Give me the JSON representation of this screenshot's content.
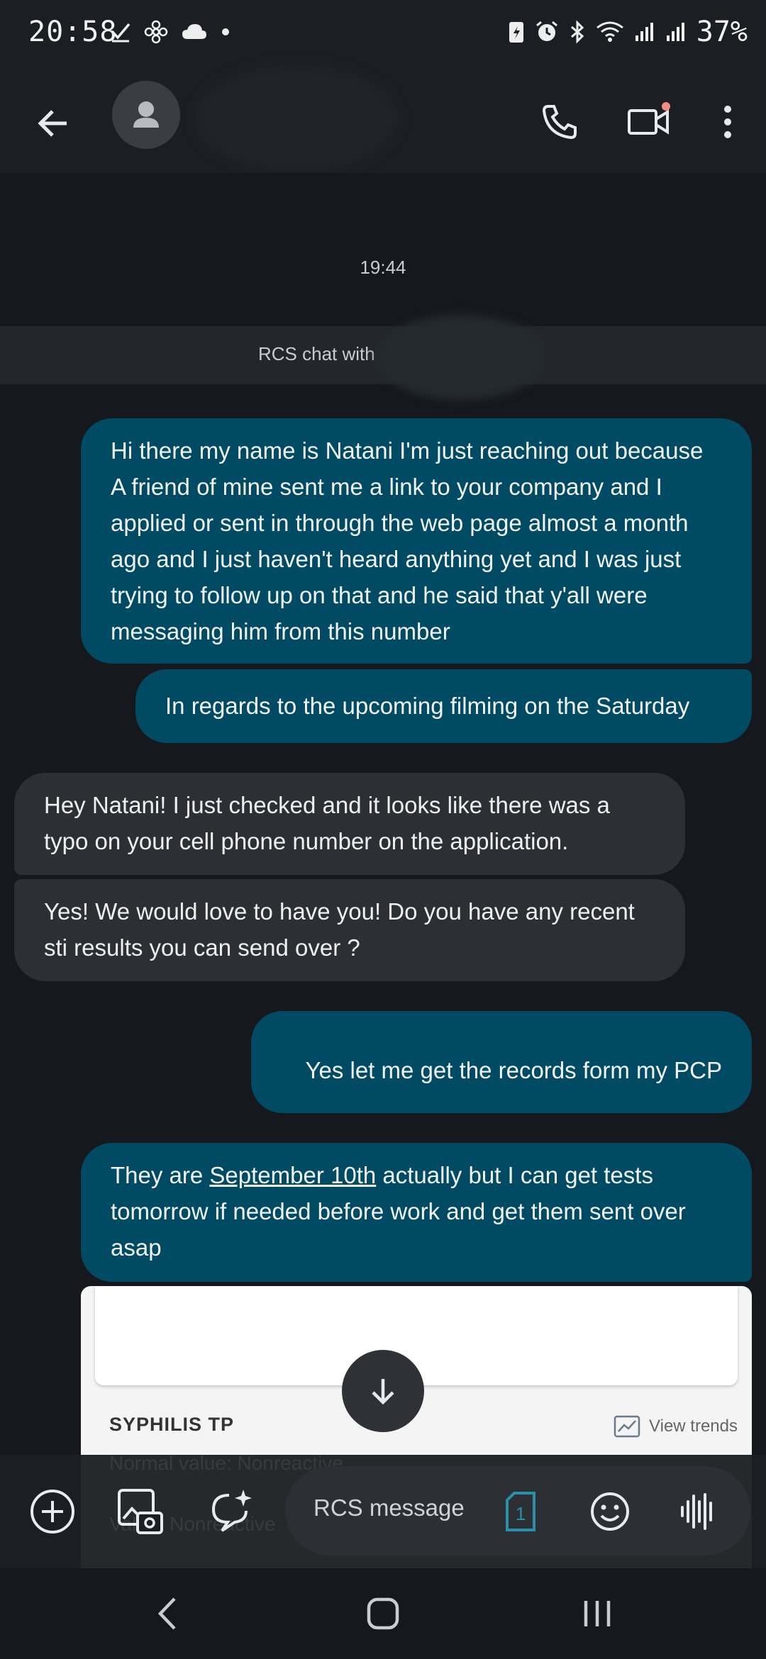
{
  "status_bar": {
    "time": "20:58",
    "battery": "37%",
    "icons": [
      "check-icon",
      "fan-icon",
      "cloud-icon",
      "dot-icon",
      "battery-saver-icon",
      "alarm-icon",
      "bluetooth-icon",
      "wifi-icon",
      "signal-icon",
      "signal-icon",
      "battery-icon"
    ]
  },
  "app_bar": {
    "icons": [
      "back-arrow-icon",
      "person-icon",
      "phone-icon",
      "video-call-icon",
      "more-vert-icon"
    ]
  },
  "conversation": {
    "timestamp": "19:44",
    "rcs_banner": "RCS chat with",
    "messages": [
      {
        "direction": "outgoing",
        "text": "Hi there my name is Natani I'm just reaching out because A friend of mine sent me a link to your company and I applied or sent in through the web page almost a month ago and I just haven't heard anything yet and I was just trying to follow up on that and he said that y'all were messaging him from this number"
      },
      {
        "direction": "outgoing",
        "text": "In regards to the upcoming filming on the Saturday"
      },
      {
        "direction": "incoming",
        "text": "Hey Natani! I just checked and it looks like there was a typo on your cell phone number on the application."
      },
      {
        "direction": "incoming",
        "text": "Yes! We would love to have you! Do you have any recent sti results you can send over ?"
      },
      {
        "direction": "outgoing",
        "text": "Yes let me get the records form my PCP"
      },
      {
        "direction": "outgoing",
        "text_before": "They are ",
        "link": "September 10th",
        "text_after": " actually but I can get tests tomorrow if needed before work and get them sent over asap"
      }
    ],
    "attachment": {
      "title": "SYPHILIS TP",
      "link_label": "View trends"
    }
  },
  "compose": {
    "placeholder": "RCS message",
    "sim_label": "1",
    "ghost_text_1": "Normal value: Nonreactive",
    "ghost_text_2": "Value: Nonreactive"
  },
  "colors": {
    "outgoing_bubble": "#004a63",
    "incoming_bubble": "#2c2f33",
    "background": "#15191d",
    "accent": "#2a8fa8"
  }
}
